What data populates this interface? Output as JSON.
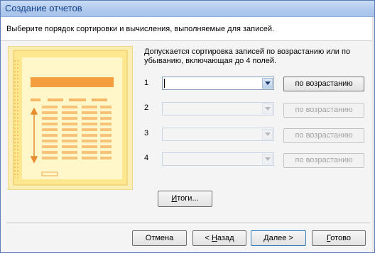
{
  "window": {
    "title": "Создание отчетов"
  },
  "header": {
    "instruction": "Выберите порядок сортировки и вычисления, выполняемые для записей."
  },
  "info": {
    "text": "Допускается сортировка записей по возрастанию или по убыванию, включающая до 4 полей."
  },
  "sort_rows": [
    {
      "number": "1",
      "field_value": "",
      "button_label": "по возрастанию",
      "enabled": true
    },
    {
      "number": "2",
      "field_value": "",
      "button_label": "по возрастанию",
      "enabled": false
    },
    {
      "number": "3",
      "field_value": "",
      "button_label": "по возрастанию",
      "enabled": false
    },
    {
      "number": "4",
      "field_value": "",
      "button_label": "по возрастанию",
      "enabled": false
    }
  ],
  "totals_button": {
    "label_u": "И",
    "label_rest": "тоги..."
  },
  "footer": {
    "cancel": "Отмена",
    "back_pre": "< ",
    "back_u": "Н",
    "back_rest": "азад",
    "next_u": "Д",
    "next_rest": "алее >",
    "finish_u": "Г",
    "finish_rest": "отово"
  },
  "icons": {
    "combo_arrow": "chevron-down-icon",
    "report_illustration": "report-preview-icon",
    "sort_arrow": "double-arrow-icon"
  },
  "colors": {
    "titlebar": "#b2cbee",
    "title_text": "#15428b",
    "illustration_page": "#fbe69a",
    "illustration_header": "#f29e3f"
  }
}
